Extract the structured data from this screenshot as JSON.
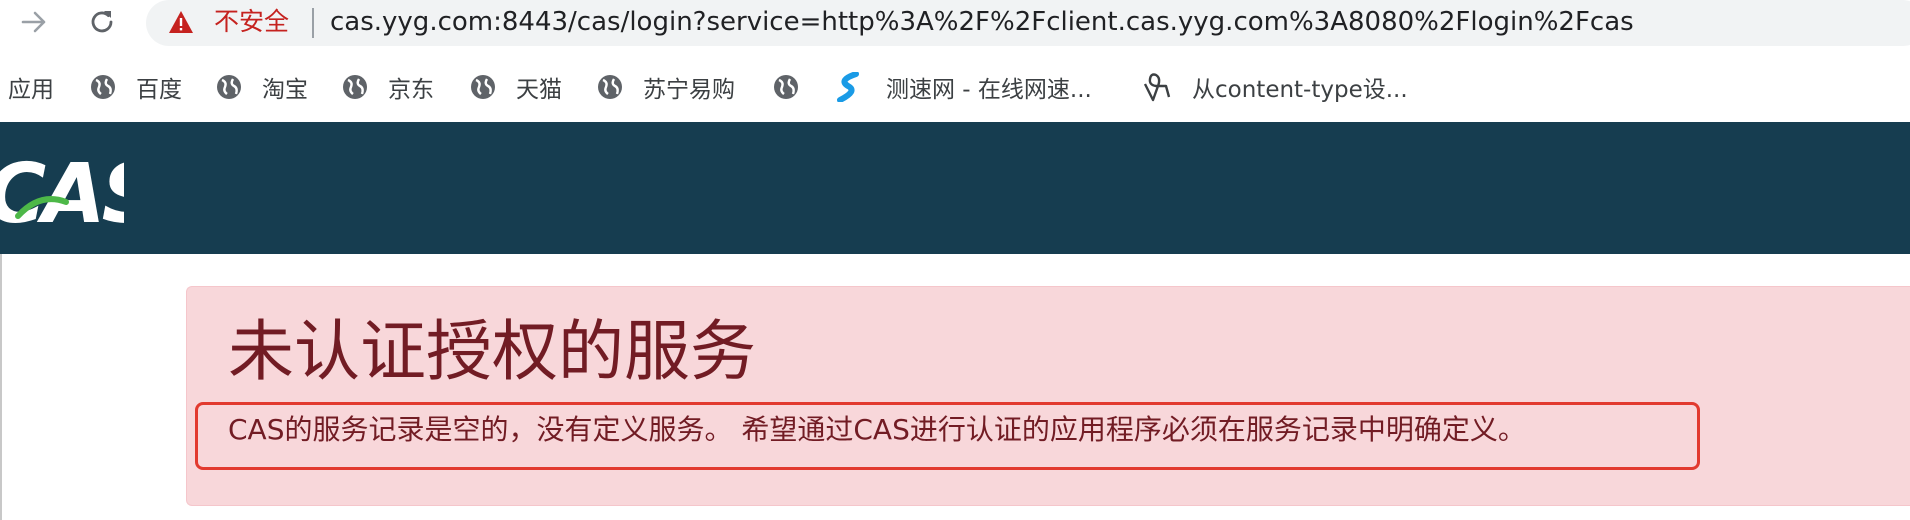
{
  "browser": {
    "security_label": "不安全",
    "url": "cas.yyg.com:8443/cas/login?service=http%3A%2F%2Fclient.cas.yyg.com%3A8080%2Flogin%2Fcas"
  },
  "bookmarks": {
    "apps": "应用",
    "items": [
      {
        "label": "百度",
        "icon": "globe-icon"
      },
      {
        "label": "淘宝",
        "icon": "globe-icon"
      },
      {
        "label": "京东",
        "icon": "globe-icon"
      },
      {
        "label": "天猫",
        "icon": "globe-icon"
      },
      {
        "label": "苏宁易购",
        "icon": "globe-icon"
      },
      {
        "label": "",
        "icon": "globe-icon"
      },
      {
        "label": "测速网 - 在线网速...",
        "icon": "speedtest-icon"
      },
      {
        "label": "从content-type设...",
        "icon": "page-icon"
      }
    ]
  },
  "header": {
    "logo_text": "CAS",
    "background_color": "#163d50"
  },
  "alert": {
    "title": "未认证授权的服务",
    "message": "CAS的服务记录是空的，没有定义服务。 希望通过CAS进行认证的应用程序必须在服务记录中明确定义。",
    "background_color": "#f8d7da",
    "text_color": "#721c24"
  }
}
